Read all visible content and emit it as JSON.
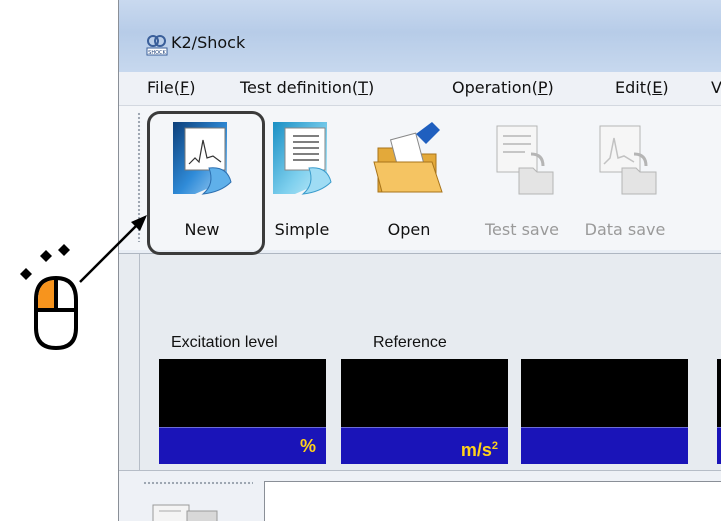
{
  "window": {
    "title": "K2/Shock",
    "app_icon": "k2-shock-icon"
  },
  "menu": [
    {
      "label": "File(F)",
      "base": "File(",
      "mnemonic": "F",
      "tail": ")"
    },
    {
      "label": "Test definition(T)",
      "base": "Test definition(",
      "mnemonic": "T",
      "tail": ")"
    },
    {
      "label": "Operation(P)",
      "base": "Operation(",
      "mnemonic": "P",
      "tail": ")"
    },
    {
      "label": "Edit(E)",
      "base": "Edit(",
      "mnemonic": "E",
      "tail": ")"
    },
    {
      "label": "V",
      "base": "V",
      "mnemonic": "",
      "tail": ""
    }
  ],
  "toolbar": {
    "buttons": [
      {
        "label": "New",
        "icon": "new-document-icon",
        "enabled": true,
        "highlighted": true
      },
      {
        "label": "Simple",
        "icon": "simple-document-icon",
        "enabled": true
      },
      {
        "label": "Open",
        "icon": "open-folder-icon",
        "enabled": true
      },
      {
        "label": "Test save",
        "icon": "test-save-icon",
        "enabled": false
      },
      {
        "label": "Data save",
        "icon": "data-save-icon",
        "enabled": false
      }
    ]
  },
  "meters": {
    "labels": [
      "Excitation level",
      "Reference"
    ],
    "units": [
      "%",
      "m/s",
      ""
    ],
    "unit_superscript": "2"
  },
  "colors": {
    "meter_value_bg": "#000000",
    "meter_unit_bg": "#1a14b8",
    "meter_unit_text": "#ffd21a",
    "mouse_button_accent": "#f7941d"
  },
  "annotation": {
    "icon": "mouse-click-icon",
    "target": "New"
  }
}
